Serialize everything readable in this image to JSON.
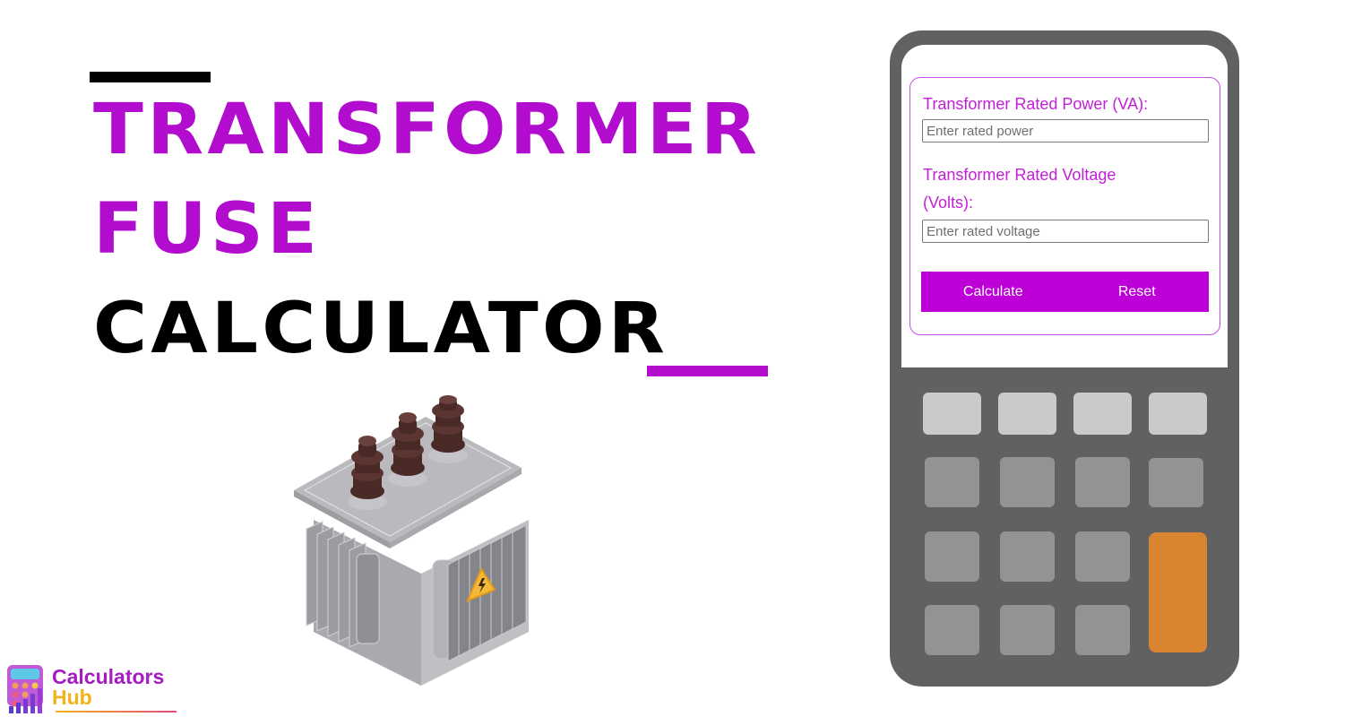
{
  "title": {
    "line1": "TRANSFORMER",
    "line2": "FUSE",
    "line3": "CALCULATOR",
    "accent_color": "#b20dce"
  },
  "logo": {
    "line1": "Calculators",
    "line2": "Hub"
  },
  "illustration": {
    "icon": "transformer-icon",
    "warning_icon": "high-voltage-warning-icon"
  },
  "form": {
    "power_label": "Transformer Rated Power (VA):",
    "power_placeholder": "Enter rated power",
    "power_value": "",
    "voltage_label_line1": "Transformer Rated Voltage",
    "voltage_label_line2": "(Volts):",
    "voltage_placeholder": "Enter rated voltage",
    "voltage_value": "",
    "calculate_label": "Calculate",
    "reset_label": "Reset",
    "button_color": "#bd00d8"
  },
  "calculator_body": {
    "body_color": "#606163",
    "key_colors": {
      "top_row": "#cbcac8",
      "keys": "#939393",
      "equals": "#d98530"
    }
  }
}
